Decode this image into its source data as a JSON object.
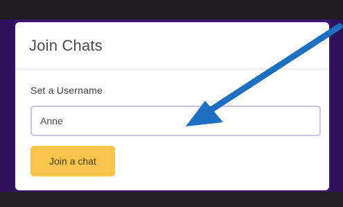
{
  "card": {
    "title": "Join Chats"
  },
  "form": {
    "username_label": "Set a Username",
    "username_value": "Anne",
    "submit_label": "Join a chat"
  },
  "colors": {
    "page_background": "#3a1670",
    "card_background": "#ffffff",
    "input_border": "#c9c2e4",
    "button_background": "#f8c44c",
    "annotation_arrow": "#1e6fc2"
  },
  "annotation": {
    "icon": "arrow-icon"
  }
}
